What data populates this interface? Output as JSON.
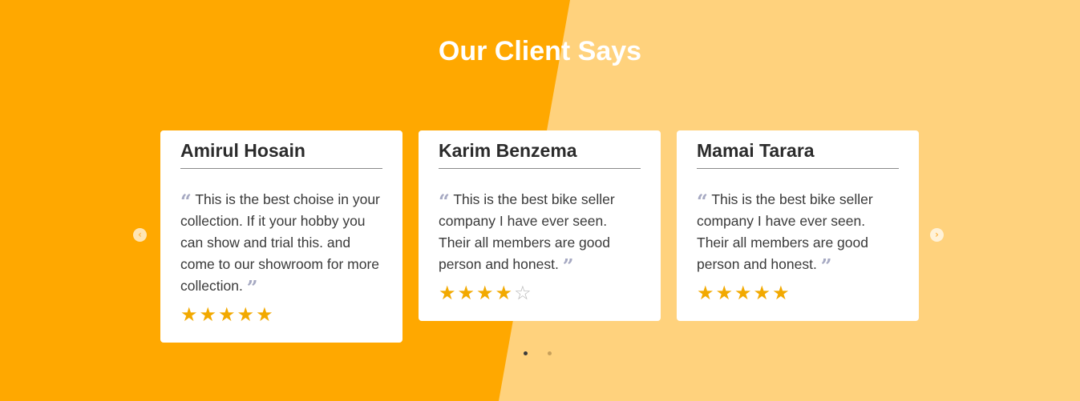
{
  "section": {
    "title": "Our Client Says"
  },
  "testimonials": [
    {
      "name": "Amirul Hosain",
      "text": "This is the best choise in your collection. If it your hobby you can show and trial this. and come to our showroom for more collection.",
      "rating": 5,
      "rating_max": 5
    },
    {
      "name": "Karim Benzema",
      "text": "This is the best bike seller company I have ever seen. Their all members are good person and honest.",
      "rating": 4,
      "rating_max": 5
    },
    {
      "name": "Mamai Tarara",
      "text": "This is the best bike seller company I have ever seen. Their all members are good person and honest.",
      "rating": 5,
      "rating_max": 5
    }
  ],
  "carousel": {
    "prev_icon": "chevron-left-icon",
    "next_icon": "chevron-right-icon",
    "page_count": 2,
    "active_page": 1
  },
  "colors": {
    "background_primary": "#ffa800",
    "background_secondary": "#ffd27d",
    "star": "#f2a900",
    "quote": "#a6a9c2"
  }
}
